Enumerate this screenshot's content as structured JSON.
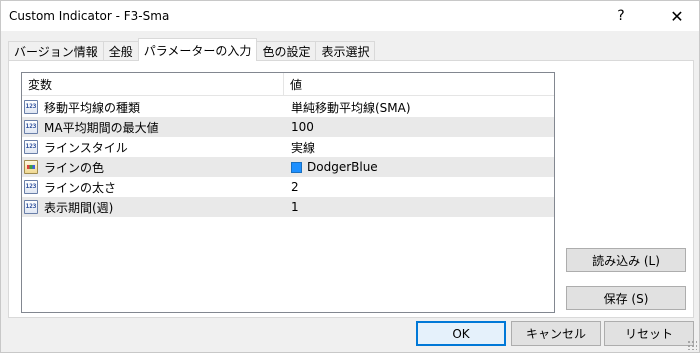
{
  "window": {
    "title": "Custom Indicator - F3-Sma",
    "help_label": "?",
    "close_label": "✕"
  },
  "tabs": [
    {
      "label": "バージョン情報",
      "active": false
    },
    {
      "label": "全般",
      "active": false
    },
    {
      "label": "パラメーターの入力",
      "active": true
    },
    {
      "label": "色の設定",
      "active": false
    },
    {
      "label": "表示選択",
      "active": false
    }
  ],
  "grid": {
    "headers": {
      "variable": "変数",
      "value": "値"
    },
    "rows": [
      {
        "icon": "123",
        "name": "移動平均線の種類",
        "value": "単純移動平均線(SMA)"
      },
      {
        "icon": "123",
        "name": "MA平均期間の最大値",
        "value": "100"
      },
      {
        "icon": "123",
        "name": "ラインスタイル",
        "value": "実線"
      },
      {
        "icon": "palette",
        "name": "ラインの色",
        "value": "DodgerBlue",
        "swatch": "#1E90FF"
      },
      {
        "icon": "123",
        "name": "ラインの太さ",
        "value": "2"
      },
      {
        "icon": "123",
        "name": "表示期間(週)",
        "value": "1"
      }
    ]
  },
  "side_buttons": {
    "load": "読み込み (L)",
    "save": "保存 (S)"
  },
  "footer": {
    "ok": "OK",
    "cancel": "キャンセル",
    "reset": "リセット"
  },
  "colors": {
    "accent": "#0078d7",
    "row_alt": "#e9e9e9",
    "dodger_blue": "#1E90FF"
  }
}
